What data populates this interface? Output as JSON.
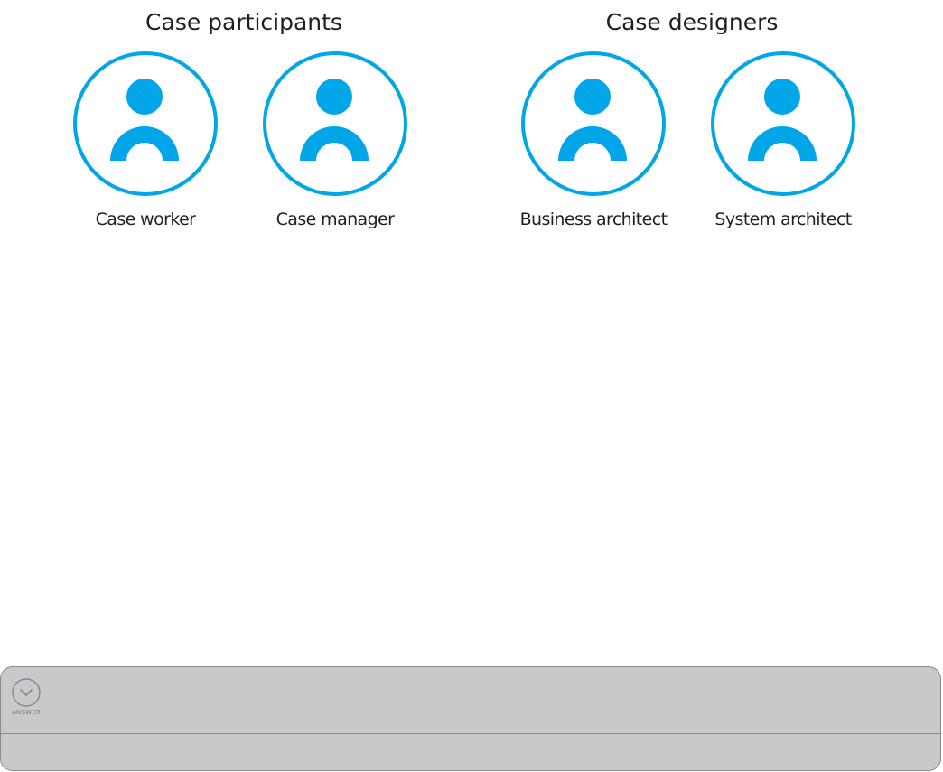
{
  "groups": [
    {
      "title": "Case participants",
      "personas": [
        {
          "label": "Case worker",
          "icon": "person-icon"
        },
        {
          "label": "Case manager",
          "icon": "person-icon"
        }
      ]
    },
    {
      "title": "Case designers",
      "personas": [
        {
          "label": "Business architect",
          "icon": "person-icon"
        },
        {
          "label": "System architect",
          "icon": "person-icon"
        }
      ]
    }
  ],
  "answer": {
    "caption": "ANSWER",
    "icon": "chevron-down-icon"
  },
  "colors": {
    "accent": "#00a6e8",
    "panel": "#c9c9c9"
  }
}
